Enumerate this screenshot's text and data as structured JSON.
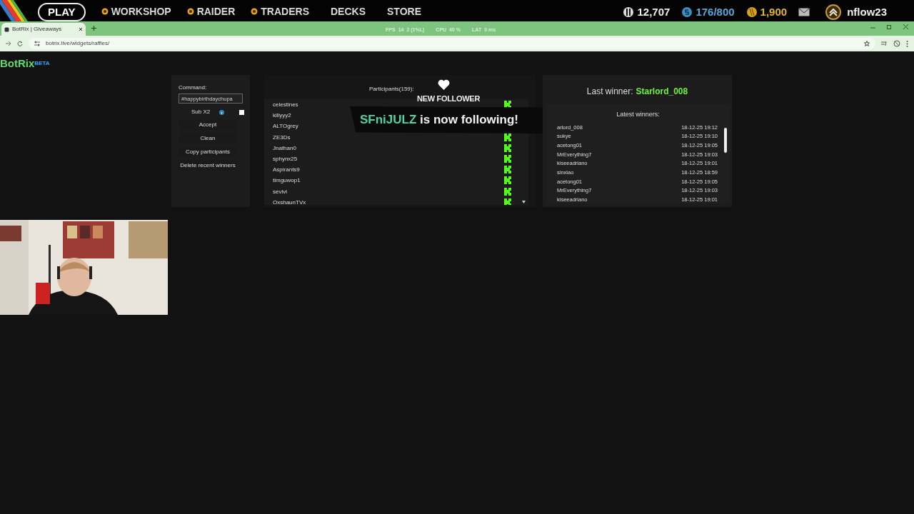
{
  "hud": {
    "nav": [
      {
        "label": "PLAY",
        "kind": "pill"
      },
      {
        "label": "WORKSHOP",
        "kind": "dot"
      },
      {
        "label": "RAIDER",
        "kind": "dot"
      },
      {
        "label": "TRADERS",
        "kind": "dot"
      },
      {
        "label": "DECKS",
        "kind": "plain"
      },
      {
        "label": "STORE",
        "kind": "plain"
      }
    ],
    "stats": [
      {
        "kind": "coin",
        "value": "12,707"
      },
      {
        "kind": "token",
        "value": "176/800"
      },
      {
        "kind": "gold",
        "value": "1,900"
      }
    ],
    "username": "nflow23"
  },
  "perf_overlay": [
    "FPS",
    "14",
    "2 (1%L)",
    "CPU",
    "40 %",
    "LAT",
    "0 ms"
  ],
  "browser": {
    "tab": {
      "title": "BotRix | Giveaways"
    },
    "url": "botrix.live/widgets/raffles/"
  },
  "brand": {
    "name": "BotRix",
    "badge": "BETA"
  },
  "controls": {
    "command_label": "Command:",
    "command_value": "#happybirthdaychupa",
    "sub_label": "Sub X2",
    "sub_checked": false,
    "buttons": [
      "Accept",
      "Clean",
      "Copy participants",
      "Delete recent winners"
    ]
  },
  "participants": {
    "title": "Participants(159):",
    "items": [
      "celestines",
      "killyyy2",
      "ALTOgrey",
      "ZE3Ds",
      "Jnathan0",
      "sphynx25",
      "Aspirants9",
      "timguwop1",
      "sevivi",
      "OxshaunTVx"
    ]
  },
  "last_winner": {
    "label": "Last winner:",
    "name": "Starlord_008"
  },
  "latest_winners": {
    "title": "Latest winners:",
    "rows": [
      {
        "name": "arlord_008",
        "time": "18-12-25 19:12"
      },
      {
        "name": "sukye",
        "time": "18-12-25 19:10"
      },
      {
        "name": "acetong01",
        "time": "18-12-25 19:05"
      },
      {
        "name": "MrEverything7",
        "time": "18-12-25 19:03"
      },
      {
        "name": "kiseeadriano",
        "time": "18-12-25 19:01"
      },
      {
        "name": "sinxiao",
        "time": "18-12-25 18:59"
      },
      {
        "name": "acetong01",
        "time": "18-12-25 19:05"
      },
      {
        "name": "MrEverything7",
        "time": "18-12-25 19:03"
      },
      {
        "name": "kiseeadriano",
        "time": "18-12-25 19:01"
      }
    ]
  },
  "notification": {
    "heading": "NEW FOLLOWER",
    "name": "SFniJULZ",
    "message": "is now following!"
  }
}
